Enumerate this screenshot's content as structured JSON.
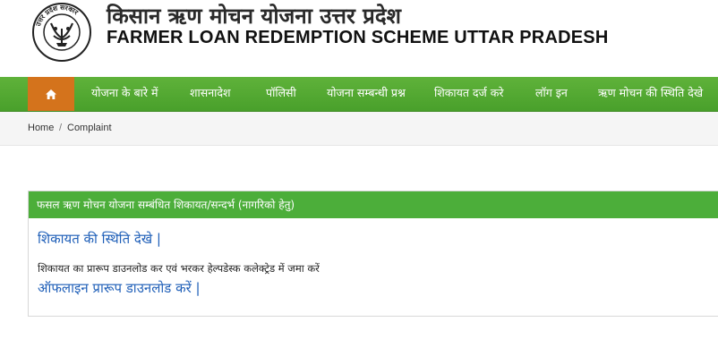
{
  "header": {
    "title_hindi": "किसान ऋण मोचन योजना उत्तर प्रदेश",
    "title_english": "FARMER LOAN REDEMPTION SCHEME UTTAR PRADESH",
    "emblem_text": "उत्तर प्रदेश सरकार",
    "emblem_icon": "up-government-emblem-icon"
  },
  "navbar": {
    "home_icon": "home-icon",
    "items": [
      {
        "label": "योजना के बारे में"
      },
      {
        "label": "शासनादेश"
      },
      {
        "label": "पॉलिसी"
      },
      {
        "label": "योजना सम्बन्धी प्रश्न"
      },
      {
        "label": "शिकायत दर्ज करे"
      },
      {
        "label": "लॉग इन"
      },
      {
        "label": "ऋण मोचन की स्थिति देखे"
      }
    ],
    "colors": {
      "bar": "#4ea62f",
      "home": "#d4731c"
    }
  },
  "breadcrumb": {
    "home": "Home",
    "separator": "/",
    "current": "Complaint"
  },
  "panel": {
    "heading": "फसल ऋण मोचन योजना सम्बंधित शिकायत/सन्दर्भ (नागरिको हेतु)",
    "status_link": "शिकायत की स्थिति देखे |",
    "note": "शिकायत का प्रारूप डाउनलोड कर एवं भरकर हेल्पडेस्क कलेक्ट्रेड में जमा करें",
    "download_link": "ऑफलाइन प्रारूप डाउनलोड करें |"
  }
}
